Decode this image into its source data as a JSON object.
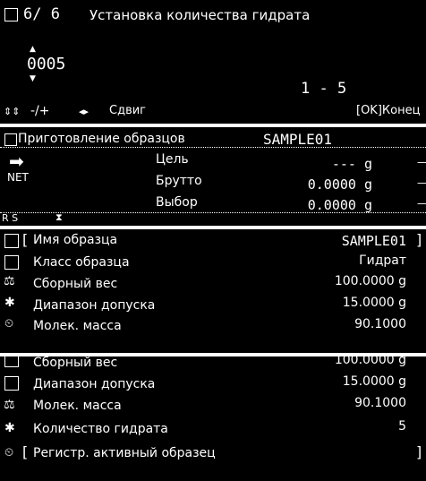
{
  "screen1": {
    "counter": "6/ 6",
    "title": "Установка количества гидрата",
    "value": "0005",
    "range": "1 - 5",
    "hint_change": "-/+",
    "hint_shift": "Сдвиг",
    "ok_key": "OK",
    "ok_label": "Конец"
  },
  "screen2": {
    "title": "Приготовление образцов",
    "sample": "SAMPLE01",
    "net_label": "NET",
    "rows": [
      {
        "label": "Цель",
        "value": "--- g"
      },
      {
        "label": "Брутто",
        "value": "0.0000 g"
      },
      {
        "label": "Выбор",
        "value": "0.0000 g"
      }
    ],
    "status": "R S"
  },
  "screen3": {
    "rows": [
      {
        "label": "Имя образца",
        "value": "SAMPLE01"
      },
      {
        "label": "Класс образца",
        "value": "Гидрат"
      },
      {
        "label": "Сборный вес",
        "value": "100.0000 g"
      },
      {
        "label": "Диапазон допуска",
        "value": "15.0000 g"
      },
      {
        "label": "Молек. масса",
        "value": "90.1000"
      }
    ]
  },
  "screen4": {
    "rows": [
      {
        "label": "Сборный вес",
        "value": "100.0000 g"
      },
      {
        "label": "Диапазон допуска",
        "value": "15.0000 g"
      },
      {
        "label": "Молек. масса",
        "value": "90.1000"
      },
      {
        "label": "Количество гидрата",
        "value": "5"
      },
      {
        "label": "Регистр. активный образец",
        "value": ""
      }
    ]
  }
}
